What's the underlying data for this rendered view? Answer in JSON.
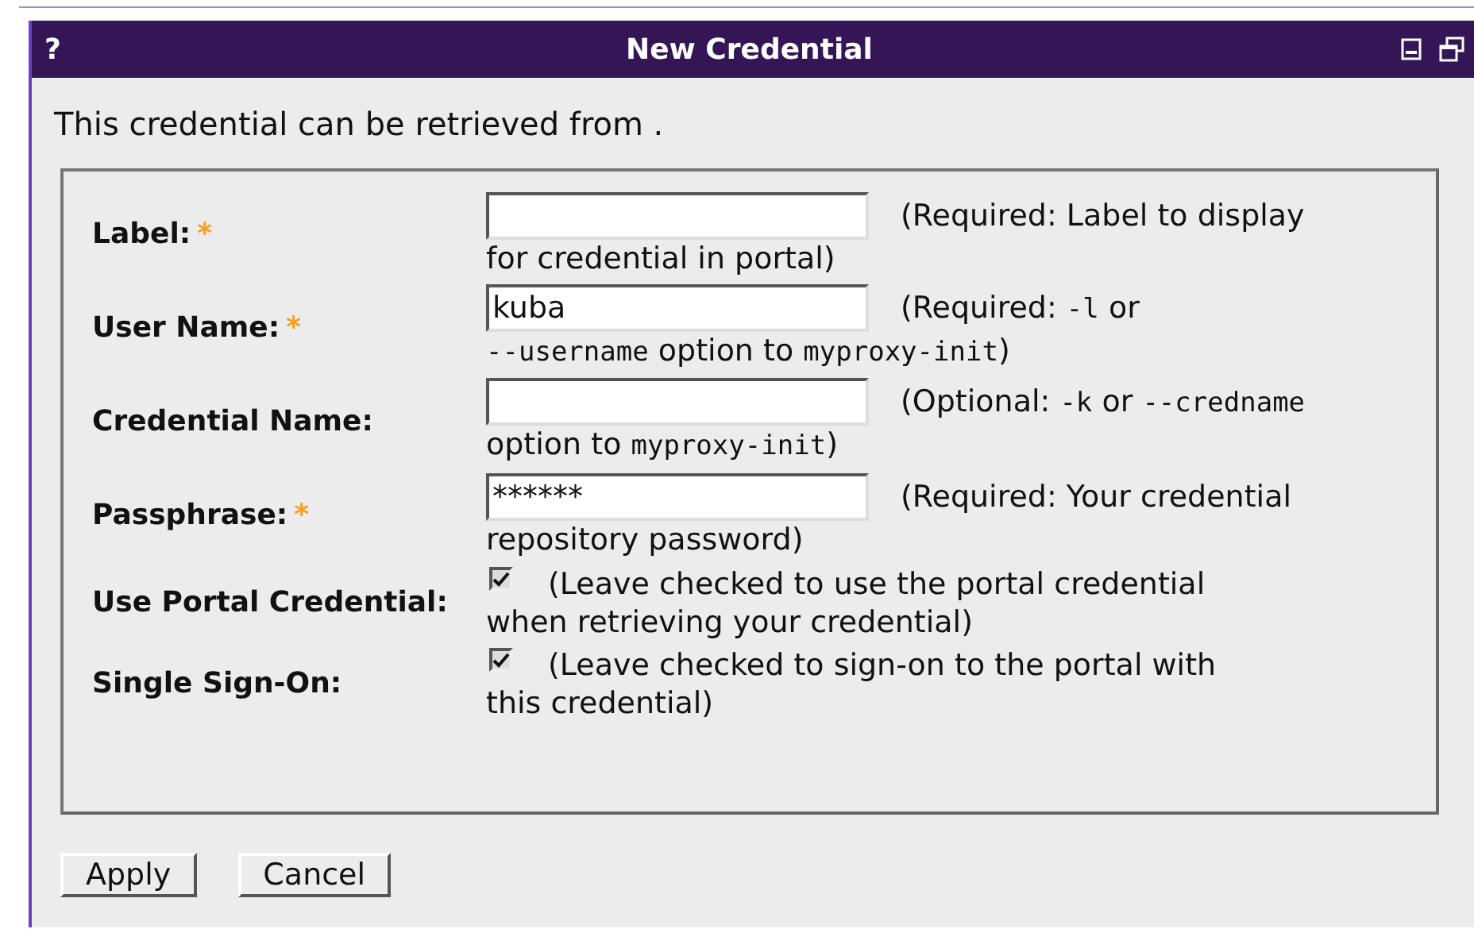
{
  "window": {
    "title": "New Credential",
    "help": "?"
  },
  "intro": "This credential can be retrieved from .",
  "fields": [
    {
      "kind": "text",
      "label": "Label:",
      "mark": "*",
      "hint_lines": [
        [
          {
            "kind": "text",
            "text": "(Required: Label to display"
          }
        ],
        [
          {
            "kind": "text",
            "text": "for credential in portal)"
          }
        ]
      ]
    },
    {
      "kind": "text",
      "label": "User Name:",
      "mark": "*",
      "value": "kuba",
      "hint_lines": [
        [
          {
            "kind": "text",
            "text": "(Required: "
          },
          {
            "kind": "code",
            "text": "-l"
          },
          {
            "kind": "text",
            "text": " or"
          }
        ],
        [
          {
            "kind": "code",
            "text": "--username"
          },
          {
            "kind": "text",
            "text": " option to "
          },
          {
            "kind": "code",
            "text": "myproxy-init"
          },
          {
            "kind": "text",
            "text": ")"
          }
        ]
      ]
    },
    {
      "kind": "text",
      "label": "Credential Name:",
      "hint_lines": [
        [
          {
            "kind": "text",
            "text": "(Optional: "
          },
          {
            "kind": "code",
            "text": "-k"
          },
          {
            "kind": "text",
            "text": " or "
          },
          {
            "kind": "code",
            "text": "--credname"
          }
        ],
        [
          {
            "kind": "text",
            "text": "option to "
          },
          {
            "kind": "code",
            "text": "myproxy-init"
          },
          {
            "kind": "text",
            "text": ")"
          }
        ]
      ]
    },
    {
      "kind": "text",
      "label": "Passphrase:",
      "mark": "*",
      "value": "******",
      "hint_lines": [
        [
          {
            "kind": "text",
            "text": "(Required: Your credential"
          }
        ],
        [
          {
            "kind": "text",
            "text": "repository password)"
          }
        ]
      ]
    },
    {
      "kind": "checkbox",
      "label": "Use Portal Credential:",
      "checked": true,
      "hint_lines": [
        [
          {
            "kind": "text",
            "text": "(Leave checked to use the portal credential"
          }
        ],
        [
          {
            "kind": "text",
            "text": "when retrieving your credential)"
          }
        ]
      ]
    },
    {
      "kind": "checkbox",
      "label": "Single Sign-On:",
      "checked": true,
      "hint_lines": [
        [
          {
            "kind": "text",
            "text": "(Leave checked to sign-on to the portal with"
          }
        ],
        [
          {
            "kind": "text",
            "text": "this credential)"
          }
        ]
      ]
    }
  ],
  "buttons": [
    "Apply",
    "Cancel"
  ]
}
